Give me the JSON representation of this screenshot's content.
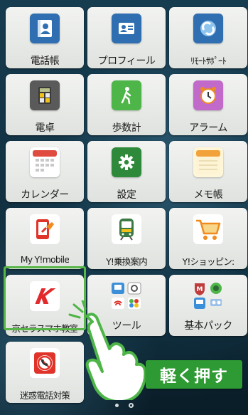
{
  "apps": [
    {
      "label": "電話帳",
      "icon": "contacts-icon",
      "color": "#2f6fb1"
    },
    {
      "label": "プロフィール",
      "icon": "profile-card-icon",
      "color": "#2f6fb1"
    },
    {
      "label": "ﾘﾓｰﾄｻﾎﾟｰﾄ",
      "icon": "remote-support-icon",
      "color": "#2f6fb1"
    },
    {
      "label": "電卓",
      "icon": "calculator-icon",
      "color": "#4e4e4e"
    },
    {
      "label": "歩数計",
      "icon": "pedometer-icon",
      "color": "#4eb548"
    },
    {
      "label": "アラーム",
      "icon": "alarm-clock-icon",
      "color": "#c16ac9"
    },
    {
      "label": "カレンダー",
      "icon": "calendar-icon",
      "color": "#e04b3f"
    },
    {
      "label": "設定",
      "icon": "settings-gear-icon",
      "color": "#2e8a3a"
    },
    {
      "label": "メモ帳",
      "icon": "memo-pad-icon",
      "color": "#f2a23a"
    },
    {
      "label": "My Y!mobile",
      "icon": "my-ymobile-icon",
      "color": "#e0342a"
    },
    {
      "label": "Y!乗換案内",
      "icon": "train-transit-icon",
      "color": "#3c7a44"
    },
    {
      "label": "Y!ショッピン:",
      "icon": "shopping-cart-icon",
      "color": "#f08b1f"
    },
    {
      "label": "京セラスマホ教室",
      "icon": "kyocera-k-icon",
      "color": "#e2292b"
    },
    {
      "label": "ツール",
      "icon": "tools-folder-icon",
      "color": "#3b8fd8"
    },
    {
      "label": "基本パック",
      "icon": "basic-pack-folder-icon",
      "color": "#c03b3b"
    },
    {
      "label": "迷惑電話対策",
      "icon": "nuisance-call-block-icon",
      "color": "#e0342a"
    }
  ],
  "callout": {
    "text": "軽く押す",
    "color": "#2e9a33"
  },
  "highlight_color": "#58b548"
}
